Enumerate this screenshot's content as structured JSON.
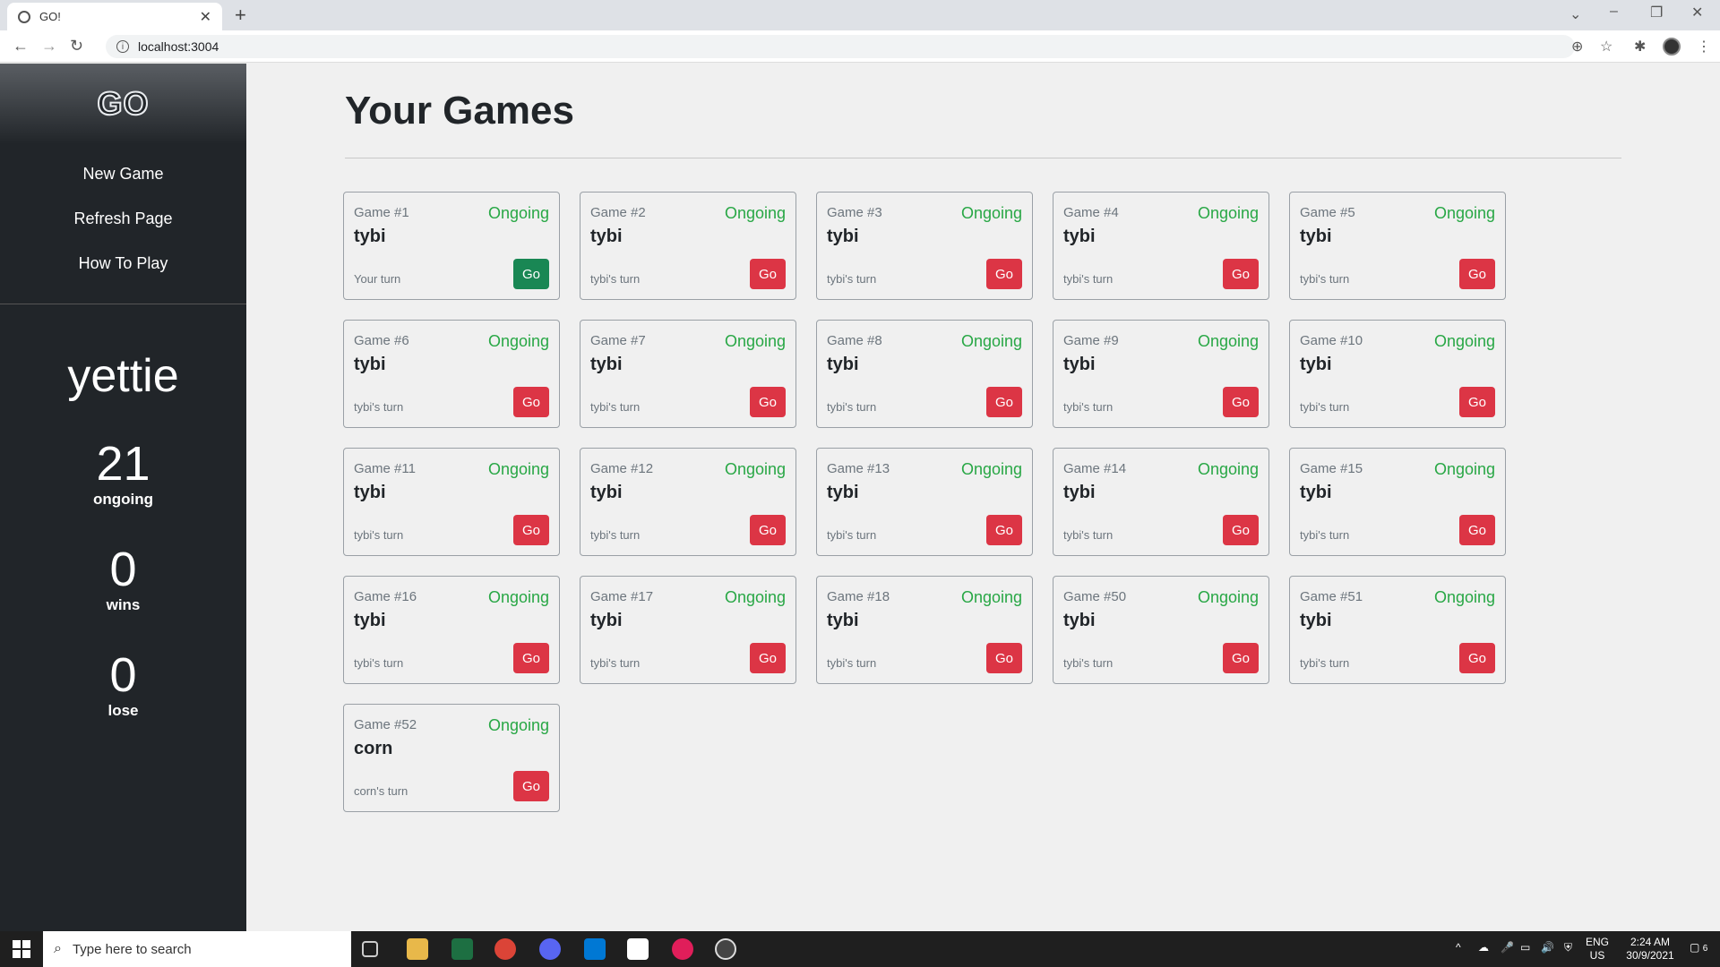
{
  "browser": {
    "tab_title": "GO!",
    "url": "localhost:3004"
  },
  "sidebar": {
    "logo": "GO",
    "nav": [
      "New Game",
      "Refresh Page",
      "How To Play"
    ],
    "username": "yettie",
    "stats": [
      {
        "value": "21",
        "label": "ongoing"
      },
      {
        "value": "0",
        "label": "wins"
      },
      {
        "value": "0",
        "label": "lose"
      }
    ]
  },
  "main": {
    "title": "Your Games",
    "go_label": "Go",
    "games": [
      {
        "num": "Game #1",
        "status": "Ongoing",
        "opponent": "tybi",
        "turn": "Your turn",
        "my_turn": true
      },
      {
        "num": "Game #2",
        "status": "Ongoing",
        "opponent": "tybi",
        "turn": "tybi's turn",
        "my_turn": false
      },
      {
        "num": "Game #3",
        "status": "Ongoing",
        "opponent": "tybi",
        "turn": "tybi's turn",
        "my_turn": false
      },
      {
        "num": "Game #4",
        "status": "Ongoing",
        "opponent": "tybi",
        "turn": "tybi's turn",
        "my_turn": false
      },
      {
        "num": "Game #5",
        "status": "Ongoing",
        "opponent": "tybi",
        "turn": "tybi's turn",
        "my_turn": false
      },
      {
        "num": "Game #6",
        "status": "Ongoing",
        "opponent": "tybi",
        "turn": "tybi's turn",
        "my_turn": false
      },
      {
        "num": "Game #7",
        "status": "Ongoing",
        "opponent": "tybi",
        "turn": "tybi's turn",
        "my_turn": false
      },
      {
        "num": "Game #8",
        "status": "Ongoing",
        "opponent": "tybi",
        "turn": "tybi's turn",
        "my_turn": false
      },
      {
        "num": "Game #9",
        "status": "Ongoing",
        "opponent": "tybi",
        "turn": "tybi's turn",
        "my_turn": false
      },
      {
        "num": "Game #10",
        "status": "Ongoing",
        "opponent": "tybi",
        "turn": "tybi's turn",
        "my_turn": false
      },
      {
        "num": "Game #11",
        "status": "Ongoing",
        "opponent": "tybi",
        "turn": "tybi's turn",
        "my_turn": false
      },
      {
        "num": "Game #12",
        "status": "Ongoing",
        "opponent": "tybi",
        "turn": "tybi's turn",
        "my_turn": false
      },
      {
        "num": "Game #13",
        "status": "Ongoing",
        "opponent": "tybi",
        "turn": "tybi's turn",
        "my_turn": false
      },
      {
        "num": "Game #14",
        "status": "Ongoing",
        "opponent": "tybi",
        "turn": "tybi's turn",
        "my_turn": false
      },
      {
        "num": "Game #15",
        "status": "Ongoing",
        "opponent": "tybi",
        "turn": "tybi's turn",
        "my_turn": false
      },
      {
        "num": "Game #16",
        "status": "Ongoing",
        "opponent": "tybi",
        "turn": "tybi's turn",
        "my_turn": false
      },
      {
        "num": "Game #17",
        "status": "Ongoing",
        "opponent": "tybi",
        "turn": "tybi's turn",
        "my_turn": false
      },
      {
        "num": "Game #18",
        "status": "Ongoing",
        "opponent": "tybi",
        "turn": "tybi's turn",
        "my_turn": false
      },
      {
        "num": "Game #50",
        "status": "Ongoing",
        "opponent": "tybi",
        "turn": "tybi's turn",
        "my_turn": false
      },
      {
        "num": "Game #51",
        "status": "Ongoing",
        "opponent": "tybi",
        "turn": "tybi's turn",
        "my_turn": false
      },
      {
        "num": "Game #52",
        "status": "Ongoing",
        "opponent": "corn",
        "turn": "corn's turn",
        "my_turn": false
      }
    ]
  },
  "taskbar": {
    "search_placeholder": "Type here to search",
    "lang": "ENG",
    "region": "US",
    "time": "2:24 AM",
    "date": "30/9/2021",
    "notification_count": "6"
  },
  "colors": {
    "go_red": "#dc3545",
    "go_green": "#198754",
    "ongoing_green": "#28a745",
    "sidebar_bg": "#212529"
  }
}
